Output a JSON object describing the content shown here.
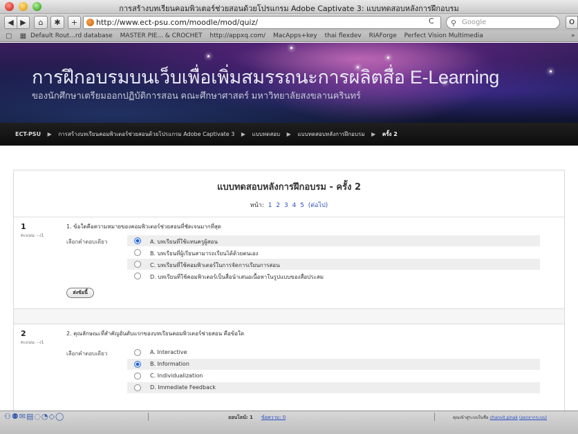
{
  "window": {
    "title": "การสร้างบทเรียนคอมพิวเตอร์ช่วยสอนด้วยโปรแกรม Adobe Captivate 3: แบบทดสอบหลังการฝึกอบรม"
  },
  "toolbar": {
    "back_label": "◀",
    "forward_label": "▶",
    "home_label": "⌂",
    "bookmark_label": "✱",
    "add_label": "+",
    "url": "http://www.ect-psu.com/moodle/mod/quiz/",
    "reload_label": "C",
    "search_placeholder": "Google",
    "extra_label": "O"
  },
  "bookmarks": {
    "icons": "▢ ▦",
    "items": [
      "Default Rout...rd database",
      "MASTER PIE... & CROCHET",
      "http://appxq.com/",
      "MacApps+key",
      "thai flexdev",
      "RIAForge",
      "Perfect Vision Multimedia"
    ],
    "more": "»"
  },
  "banner": {
    "title": "การฝึกอบรมบนเว็บเพื่อเพิ่มสมรรถนะการผลิตสื่อ E-Learning",
    "subtitle": "ของนักศึกษาเตรียมออกปฏิบัติการสอน คณะศึกษาศาสตร์ มหาวิทยาลัยสงขลานครินทร์"
  },
  "breadcrumb": {
    "items": [
      "ECT-PSU",
      "การสร้างบทเรียนคอมพิวเตอร์ช่วยสอนด้วยโปรแกรม Adobe Captivate 3",
      "แบบทดสอบ",
      "แบบทดสอบหลังการฝึกอบรม",
      "ครั้ง 2"
    ],
    "separator": "▶"
  },
  "quiz": {
    "title": "แบบทดสอบหลังการฝึกอบรม - ครั้ง 2",
    "pages_label": "หน้า:",
    "pages": [
      "1",
      "2",
      "3",
      "4",
      "5"
    ],
    "next_label": "(ต่อไป)",
    "questions": [
      {
        "number": "1",
        "marks": "คะแนน: --/1",
        "text": "1. ข้อใดคือความหมายของคอมพิวเตอร์ช่วยสอนที่ชัดเจนมากที่สุด",
        "prompt": "เลือกคำตอบเดียว",
        "options": [
          "A. บทเรียนที่ใช้แทนครูผู้สอน",
          "B. บทเรียนที่ผู้เรียนสามารถเรียนได้ด้วยตนเอง",
          "C. บทเรียนที่ใช้คอมพิวเตอร์ในการจัดการเรียนการสอน",
          "D. บทเรียนที่ใช้คอมพิวเตอร์เป็นสื่อนำเสนอเนื้อหาในรูปแบบของสื่อประสม"
        ],
        "selected": 0,
        "submit_label": "ส่งข้อนี้"
      },
      {
        "number": "2",
        "marks": "คะแนน: --/1",
        "text": "2. คุณลักษณะที่สำคัญอันดับแรกของบทเรียนคอมพิวเตอร์ช่วยสอน คือข้อใด",
        "prompt": "เลือกคำตอบเดียว",
        "options": [
          "A. Interactive",
          "B. Information",
          "C. Individualization",
          "D. Immediate Feedback"
        ],
        "selected": 1
      }
    ]
  },
  "statusbar": {
    "icons": "⚇⚉✉▤◌◔◇◯",
    "online_label": "ออนไลน์: 1",
    "messages_label": "ข้อความ: 0",
    "user_prefix": "คุณเข้าสู่ระบบในชื่อ",
    "user_name": "chanvit.pinak",
    "logout_label": "(ออกจากระบบ)"
  }
}
